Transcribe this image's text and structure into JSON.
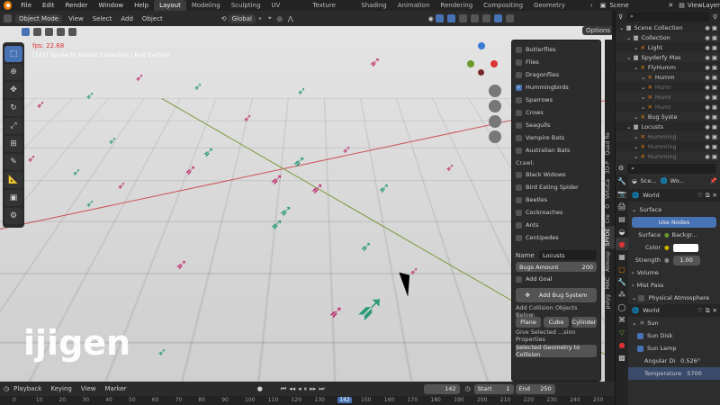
{
  "topbar": {
    "menus": [
      "File",
      "Edit",
      "Render",
      "Window",
      "Help"
    ],
    "workspaces": [
      "Layout",
      "Modeling",
      "Sculpting",
      "UV Editing",
      "Texture Paint",
      "Shading",
      "Animation",
      "Rendering",
      "Compositing",
      "Geometry Nodes"
    ],
    "active_workspace": "Layout",
    "scene": "Scene",
    "view_layer": "ViewLayer"
  },
  "viewport_header": {
    "mode": "Object Mode",
    "menus": [
      "View",
      "Select",
      "Add",
      "Object"
    ],
    "transform_orientation": "Global",
    "options": "Options"
  },
  "viewport": {
    "fps": "fps: 22.68",
    "info": "(142) Spyderfy Master Collection | Bug System",
    "watermark": "ijigen"
  },
  "npanel": {
    "flyers": [
      {
        "label": "Butterflies",
        "checked": false
      },
      {
        "label": "Flies",
        "checked": false
      },
      {
        "label": "Dragonflies",
        "checked": false
      },
      {
        "label": "Hummingbirds",
        "checked": true
      },
      {
        "label": "Sparrows",
        "checked": false
      },
      {
        "label": "Crows",
        "checked": false
      },
      {
        "label": "Seagulls",
        "checked": false
      },
      {
        "label": "Vampire Bats",
        "checked": false
      },
      {
        "label": "Australian Bats",
        "checked": false
      }
    ],
    "crawl_label": "Crawl:",
    "crawlers": [
      {
        "label": "Black Widows",
        "checked": false
      },
      {
        "label": "Bird Eating Spider",
        "checked": false
      },
      {
        "label": "Beetles",
        "checked": false
      },
      {
        "label": "Cockroaches",
        "checked": false
      },
      {
        "label": "Ants",
        "checked": false
      },
      {
        "label": "Centipedes",
        "checked": false
      }
    ],
    "name_label": "Name",
    "name_value": "Locusts",
    "bugs_amount_label": "Bugs Amount",
    "bugs_amount_value": "200",
    "add_goal": "Add Goal",
    "add_bug_system": "Add Bug System",
    "collision_label": "Add Collision Objects Below:",
    "plane": "Plane",
    "cube": "Cube",
    "cylinder": "Cylinder",
    "give_selected": "Give Selected ...sion Properties",
    "selected_geometry": "Selected Geometry to Collision"
  },
  "vtabs": [
    "VirtuCa",
    "Cre",
    "SPYDE",
    "Atmosp",
    "MAC",
    "polyg"
  ],
  "vtabs_small": [
    "Quad Re",
    "3D-P",
    "O"
  ],
  "outliner": {
    "rows": [
      {
        "label": "Scene Collection",
        "indent": 0,
        "dim": false
      },
      {
        "label": "Collection",
        "indent": 1,
        "dim": false
      },
      {
        "label": "Light",
        "indent": 2,
        "dim": false
      },
      {
        "label": "Spyderfy Mas",
        "indent": 1,
        "dim": false
      },
      {
        "label": "FlyHumm",
        "indent": 2,
        "dim": false
      },
      {
        "label": "Humm",
        "indent": 3,
        "dim": false
      },
      {
        "label": "Humr",
        "indent": 3,
        "dim": true
      },
      {
        "label": "Humr",
        "indent": 3,
        "dim": true
      },
      {
        "label": "Humr",
        "indent": 3,
        "dim": true
      },
      {
        "label": "Bug Syste",
        "indent": 2,
        "dim": false
      },
      {
        "label": "Locusts",
        "indent": 1,
        "dim": false
      },
      {
        "label": "Humming",
        "indent": 2,
        "dim": true
      },
      {
        "label": "Humming",
        "indent": 2,
        "dim": true
      },
      {
        "label": "Humming",
        "indent": 2,
        "dim": true
      }
    ]
  },
  "properties": {
    "scene_short": "Sce...",
    "world_short": "Wo...",
    "world": "World",
    "surface": "Surface",
    "use_nodes": "Use Nodes",
    "surface_label": "Surface",
    "surface_value": "Backgr...",
    "color_label": "Color",
    "strength_label": "Strength",
    "strength_value": "1.00",
    "volume": "Volume",
    "mist_pass": "Mist Pass",
    "physical_atmosphere": "Physical Atmosphere",
    "atm_world": "World",
    "sun": "Sun",
    "sun_disk": "Sun Disk",
    "sun_lamp": "Sun Lamp",
    "angular_di": "Angular Di",
    "angular_di_value": "0.526°",
    "temperature": "Temperature",
    "temperature_value": "5700"
  },
  "timeline": {
    "menus": [
      "Playback",
      "Keying",
      "View",
      "Marker"
    ],
    "current_frame": "142",
    "start_label": "Start",
    "start_value": "1",
    "end_label": "End",
    "end_value": "250",
    "ruler": [
      "0",
      "10",
      "20",
      "30",
      "40",
      "50",
      "60",
      "70",
      "80",
      "90",
      "100",
      "110",
      "120",
      "130",
      "142",
      "150",
      "160",
      "170",
      "180",
      "190",
      "200",
      "210",
      "220",
      "230",
      "240",
      "250"
    ]
  },
  "colors": {
    "accent": "#4772b3",
    "blender_orange": "#e87d0d",
    "frame_marker": "#4772b3"
  }
}
